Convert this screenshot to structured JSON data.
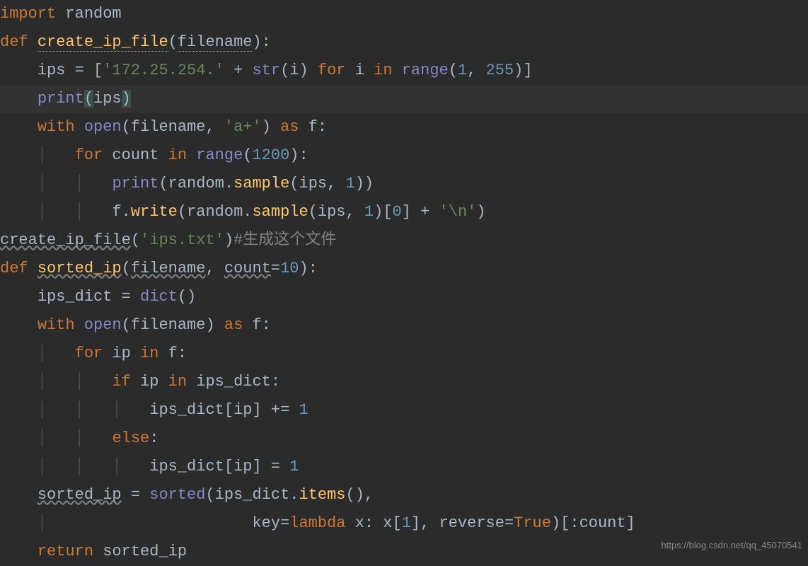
{
  "code": {
    "l1_import": "import",
    "l1_random": " random",
    "l2_def": "def",
    "l2_fn": "create_ip_file",
    "l2_param": "filename",
    "l3_ips": "ips ",
    "l3_eq": "= ",
    "l3_br": "[",
    "l3_str": "'172.25.254.'",
    "l3_plus": " + ",
    "l3_strb": "str",
    "l3_i1": "(i) ",
    "l3_for": "for",
    "l3_i2": " i ",
    "l3_in": "in",
    "l3_range": "range",
    "l3_op": "(",
    "l3_n1": "1",
    "l3_cm": ", ",
    "l3_n255": "255",
    "l3_cl": ")]",
    "l4_print": "print",
    "l4_op": "(",
    "l4_ips": "ips",
    "l4_cl": ")",
    "l5_with": "with",
    "l5_open": "open",
    "l5_fn": "(filename, ",
    "l5_str": "'a+'",
    "l5_cl": ") ",
    "l5_as": "as",
    "l5_f": " f:",
    "l6_for": "for",
    "l6_count": " count ",
    "l6_in": "in",
    "l6_range": "range",
    "l6_op": "(",
    "l6_n": "1200",
    "l6_cl": "):",
    "l7_print": "print",
    "l7_rest1": "(random.",
    "l7_sample": "sample",
    "l7_rest2": "(ips, ",
    "l7_n": "1",
    "l7_cl": "))",
    "l8_f": "f.",
    "l8_write": "write",
    "l8_r1": "(random.",
    "l8_sample": "sample",
    "l8_r2": "(ips, ",
    "l8_n1": "1",
    "l8_r3": ")[",
    "l8_n0": "0",
    "l8_r4": "] + ",
    "l8_str": "'\\n'",
    "l8_cl": ")",
    "l9_fn": "create_ip_file",
    "l9_op": "(",
    "l9_str": "'ips.txt'",
    "l9_cl": ")",
    "l9_comment": "#生成这个文件",
    "l10_def": "def",
    "l10_fn": "sorted_ip",
    "l10_p1": "filename",
    "l10_cm": ", ",
    "l10_p2": "count",
    "l10_eq": "=",
    "l10_n": "10",
    "l11_ipsd": "ips_dict = ",
    "l11_dict": "dict",
    "l11_cl": "()",
    "l12_with": "with",
    "l12_open": "open",
    "l12_fn": "(filename) ",
    "l12_as": "as",
    "l12_f": " f:",
    "l13_for": "for",
    "l13_ip": " ip ",
    "l13_in": "in",
    "l13_f": " f:",
    "l14_if": "if",
    "l14_ip": " ip ",
    "l14_in": "in",
    "l14_ipsd": " ips_dict:",
    "l15": "ips_dict[ip] += ",
    "l15_n": "1",
    "l16_else": "else",
    "l16_c": ":",
    "l17": "ips_dict[ip] = ",
    "l17_n": "1",
    "l18_sip": "sorted_ip",
    "l18_eq": " = ",
    "l18_sorted": "sorted",
    "l18_r1": "(ips_dict.",
    "l18_items": "items",
    "l18_r2": "(),",
    "l19_key": "key",
    "l19_eq": "=",
    "l19_lambda": "lambda",
    "l19_x": " x: x[",
    "l19_n1": "1",
    "l19_r1": "], ",
    "l19_rev": "reverse",
    "l19_eq2": "=",
    "l19_true": "True",
    "l19_r2": ")[:count]",
    "l20_return": "return",
    "l20_sip": " sorted_ip"
  },
  "watermark": "https://blog.csdn.net/qq_45070541"
}
